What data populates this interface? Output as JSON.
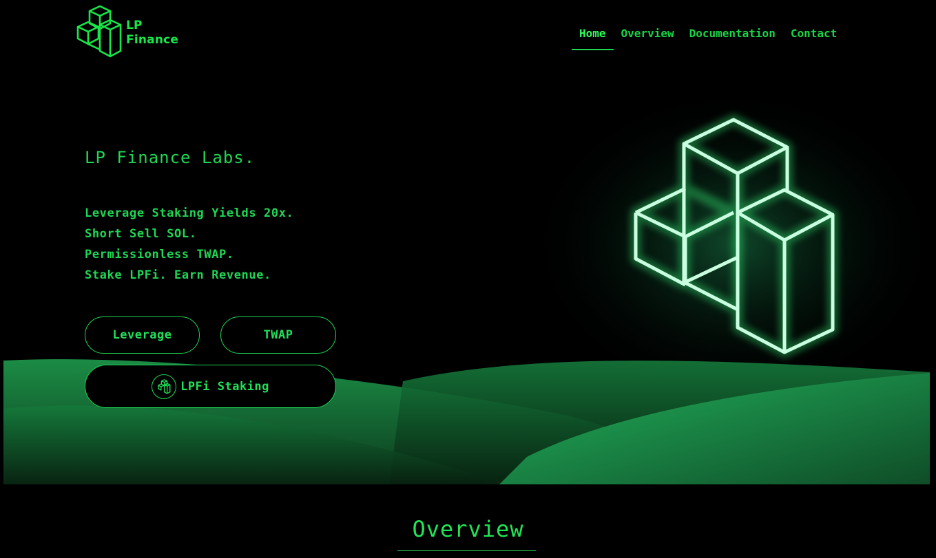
{
  "brand": {
    "line1": "LP",
    "line2": "Finance"
  },
  "nav": {
    "items": [
      {
        "label": "Home",
        "active": true
      },
      {
        "label": "Overview",
        "active": false
      },
      {
        "label": "Documentation",
        "active": false
      },
      {
        "label": "Contact",
        "active": false
      }
    ]
  },
  "hero": {
    "headline": "LP Finance Labs.",
    "taglines": [
      "Leverage Staking Yields 20x.",
      "Short Sell SOL.",
      "Permissionless TWAP.",
      "Stake LPFi. Earn Revenue."
    ],
    "buttons": {
      "leverage": "Leverage",
      "twap": "TWAP",
      "staking": "LPFi Staking"
    }
  },
  "overview": {
    "title": "Overview"
  },
  "colors": {
    "accent": "#1fd655",
    "background": "#000000",
    "hills": "#1a9e4c"
  },
  "icons": {
    "logo": "cubes-logo-icon",
    "staking": "cubes-icon",
    "hero_art": "glowing-cubes-illustration"
  }
}
